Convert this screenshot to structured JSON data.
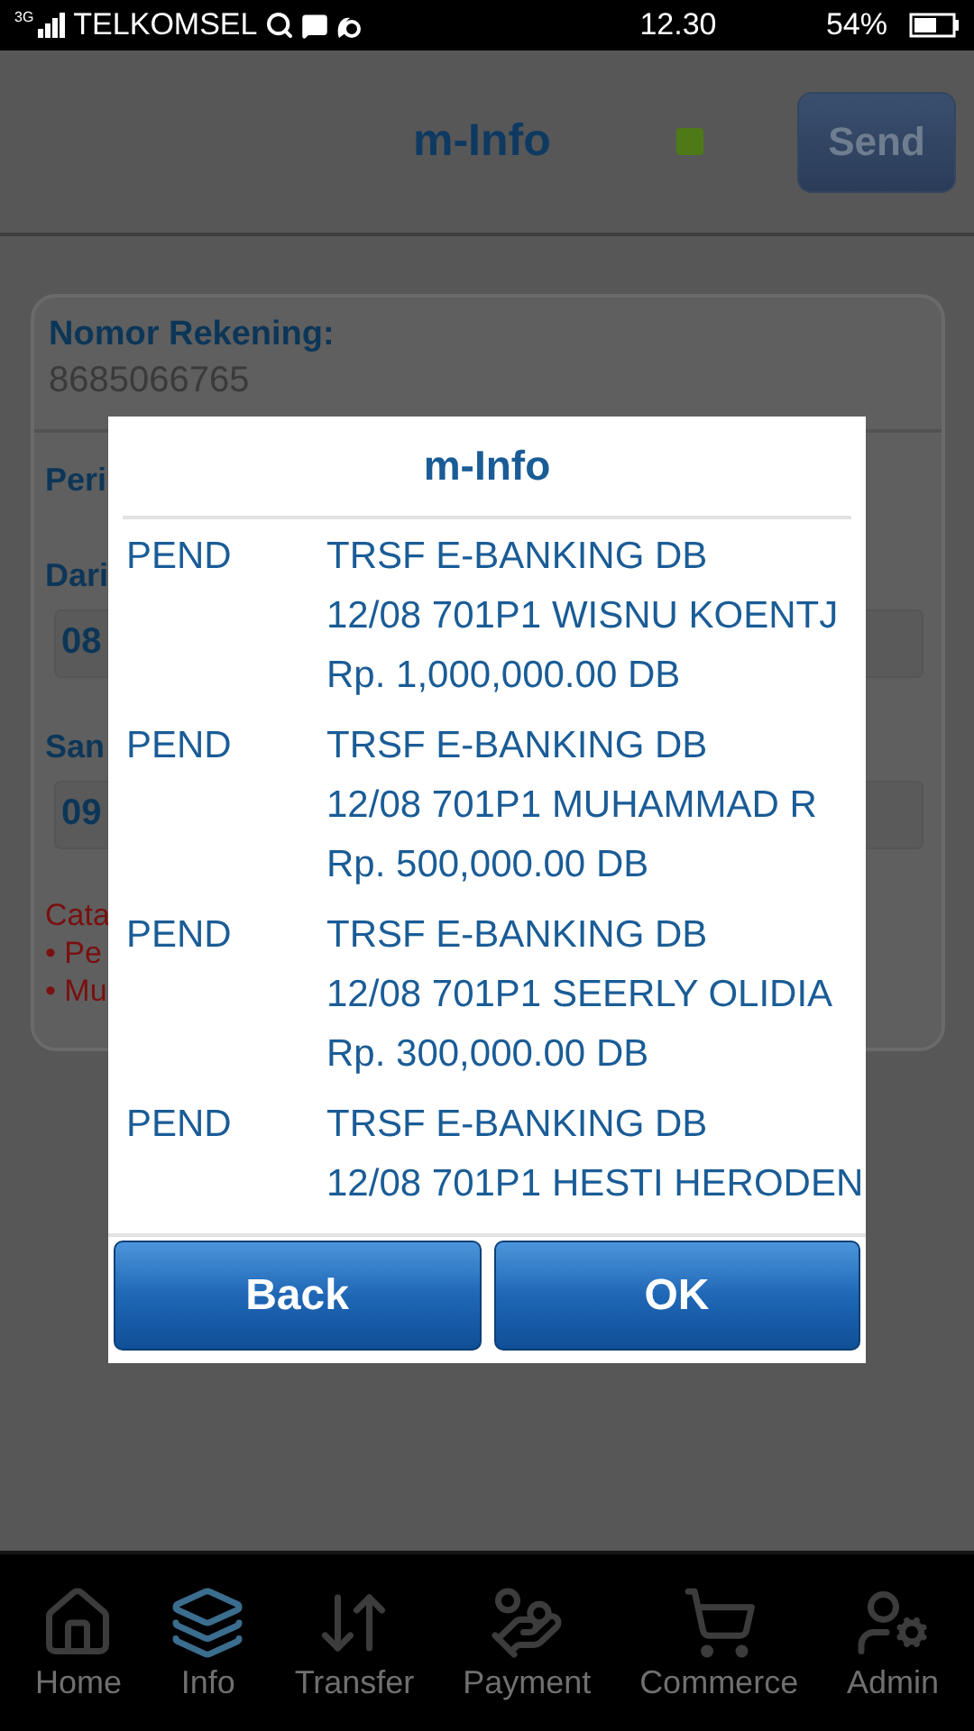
{
  "status_bar": {
    "network": "3G",
    "carrier": "TELKOMSEL",
    "time": "12.30",
    "battery": "54%"
  },
  "header": {
    "title": "m-Info",
    "send_button": "Send"
  },
  "form": {
    "account_label": "Nomor Rekening:",
    "account_number": "8685066765",
    "period_label": "Peri",
    "from_label": "Dari",
    "from_value": "08",
    "to_label": "San",
    "to_value": "09",
    "note_title": "Cata",
    "notes": [
      "• Pe",
      "• Mu"
    ]
  },
  "dialog": {
    "title": "m-Info",
    "transactions": [
      {
        "status": "PEND",
        "lines": [
          "TRSF E-BANKING DB",
          "12/08 701P1 WISNU KOENTJ",
          "Rp. 1,000,000.00 DB"
        ]
      },
      {
        "status": "PEND",
        "lines": [
          "TRSF E-BANKING DB",
          "12/08 701P1 MUHAMMAD R",
          "Rp. 500,000.00 DB"
        ]
      },
      {
        "status": "PEND",
        "lines": [
          "TRSF E-BANKING DB",
          "12/08 701P1 SEERLY OLIDIA",
          "Rp. 300,000.00 DB"
        ]
      },
      {
        "status": "PEND",
        "lines": [
          "TRSF E-BANKING DB",
          "12/08 701P1 HESTI HERODEN"
        ]
      }
    ],
    "buttons": [
      "Back",
      "OK"
    ]
  },
  "nav": [
    {
      "label": "Home",
      "selected": false
    },
    {
      "label": "Info",
      "selected": true
    },
    {
      "label": "Transfer",
      "selected": false
    },
    {
      "label": "Payment",
      "selected": false
    },
    {
      "label": "Commerce",
      "selected": false
    },
    {
      "label": "Admin",
      "selected": false
    }
  ]
}
